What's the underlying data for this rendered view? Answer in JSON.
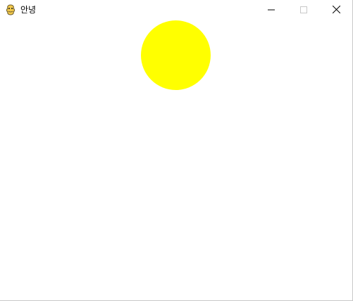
{
  "window": {
    "title": "안녕",
    "app_icon": "pygame-snake-icon",
    "controls": {
      "minimize_icon": "minimize-icon",
      "maximize_icon": "maximize-icon",
      "close_icon": "close-icon"
    }
  },
  "canvas": {
    "background_color": "#ffffff",
    "circle_color": "#ffff00"
  }
}
